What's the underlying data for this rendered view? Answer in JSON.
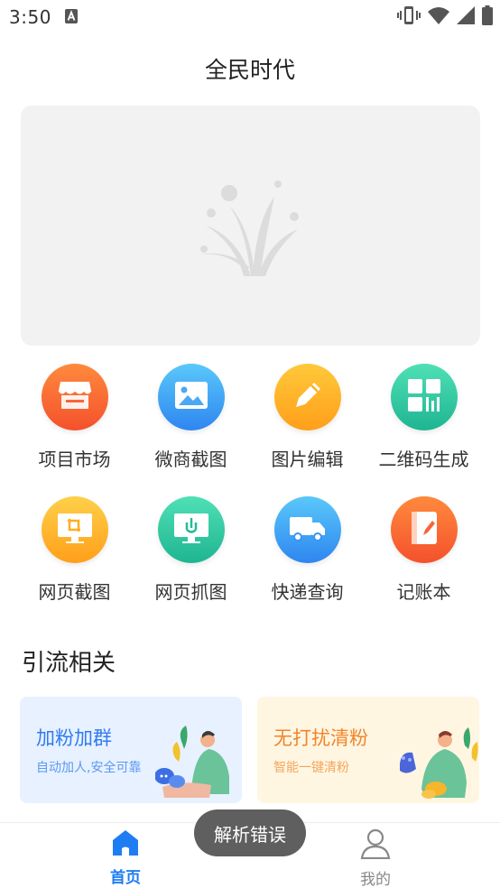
{
  "status_bar": {
    "time": "3:50"
  },
  "app": {
    "title": "全民时代"
  },
  "grid": [
    {
      "label": "项目市场",
      "icon": "store-icon",
      "color_top": "#ff8a3d",
      "color_bottom": "#f4512c"
    },
    {
      "label": "微商截图",
      "icon": "image-icon",
      "color_top": "#5ac8fa",
      "color_bottom": "#2e86f0"
    },
    {
      "label": "图片编辑",
      "icon": "pencil-icon",
      "color_top": "#ffc93a",
      "color_bottom": "#ff9f1a"
    },
    {
      "label": "二维码生成",
      "icon": "qrcode-icon",
      "color_top": "#4fe0b5",
      "color_bottom": "#1fb592"
    },
    {
      "label": "网页截图",
      "icon": "crop-icon",
      "color_top": "#ffd04a",
      "color_bottom": "#ff9f1a"
    },
    {
      "label": "网页抓图",
      "icon": "monitor-icon",
      "color_top": "#4fe0b5",
      "color_bottom": "#1fb592"
    },
    {
      "label": "快递查询",
      "icon": "truck-icon",
      "color_top": "#5ac8fa",
      "color_bottom": "#2e86f0"
    },
    {
      "label": "记账本",
      "icon": "notebook-icon",
      "color_top": "#ff8a3d",
      "color_bottom": "#f4512c"
    }
  ],
  "section": {
    "title": "引流相关"
  },
  "cards": {
    "left": {
      "title": "加粉加群",
      "subtitle": "自动加人,安全可靠"
    },
    "right": {
      "title": "无打扰清粉",
      "subtitle": "智能一键清粉"
    }
  },
  "tabbar": {
    "home": {
      "label": "首页",
      "active": true,
      "color": "#1e7df2"
    },
    "mine": {
      "label": "我的",
      "active": false,
      "color": "#888888"
    }
  },
  "toast": {
    "text": "解析错误"
  }
}
